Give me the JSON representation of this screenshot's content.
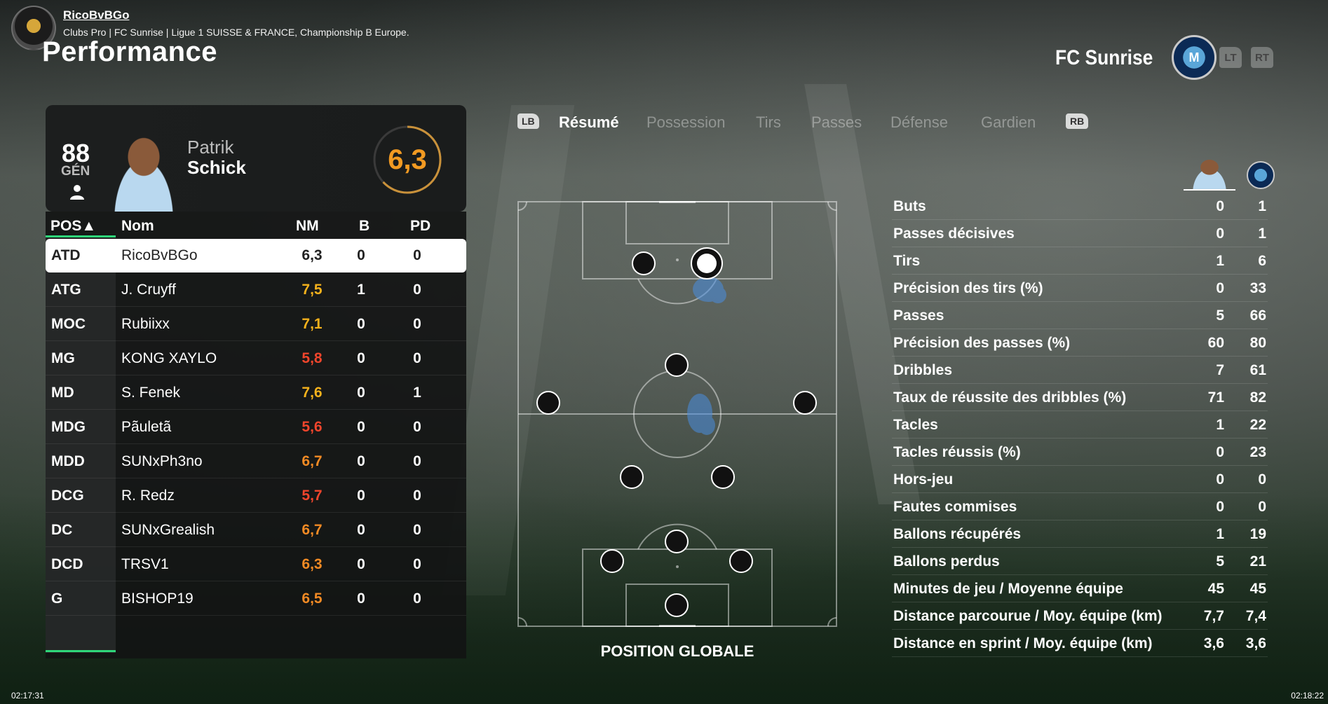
{
  "header": {
    "user_name": "RicoBvBGo",
    "subtitle": "Clubs Pro | FC Sunrise | Ligue 1 SUISSE & FRANCE, Championship B Europe.",
    "page_title": "Performance",
    "club_name": "FC Sunrise",
    "btn_lt": "LT",
    "btn_rt": "RT",
    "club_crest_text": "M"
  },
  "player": {
    "overall": "88",
    "overall_label": "GÉN",
    "first_name": "Patrik",
    "last_name": "Schick",
    "rating": "6,3",
    "rating_fraction": 0.63
  },
  "table": {
    "headers": {
      "pos": "POS▲",
      "nom": "Nom",
      "nm": "NM",
      "b": "B",
      "pd": "PD"
    },
    "rows": [
      {
        "pos": "ATD",
        "nom": "RicoBvBGo",
        "nm": "6,3",
        "b": "0",
        "pd": "0",
        "nm_color": "#222222",
        "selected": true
      },
      {
        "pos": "ATG",
        "nom": "J. Cruyff",
        "nm": "7,5",
        "b": "1",
        "pd": "0",
        "nm_color": "#f6b21c"
      },
      {
        "pos": "MOC",
        "nom": "Rubiixx",
        "nm": "7,1",
        "b": "0",
        "pd": "0",
        "nm_color": "#f6b21c"
      },
      {
        "pos": "MG",
        "nom": "KONG XAYLO",
        "nm": "5,8",
        "b": "0",
        "pd": "0",
        "nm_color": "#f0452c"
      },
      {
        "pos": "MD",
        "nom": "S. Fenek",
        "nm": "7,6",
        "b": "0",
        "pd": "1",
        "nm_color": "#f6b21c"
      },
      {
        "pos": "MDG",
        "nom": "Pãuletã",
        "nm": "5,6",
        "b": "0",
        "pd": "0",
        "nm_color": "#f0452c"
      },
      {
        "pos": "MDD",
        "nom": "SUNxPh3no",
        "nm": "6,7",
        "b": "0",
        "pd": "0",
        "nm_color": "#f28a24"
      },
      {
        "pos": "DCG",
        "nom": "R. Redz",
        "nm": "5,7",
        "b": "0",
        "pd": "0",
        "nm_color": "#f0452c"
      },
      {
        "pos": "DC",
        "nom": "SUNxGrealish",
        "nm": "6,7",
        "b": "0",
        "pd": "0",
        "nm_color": "#f28a24"
      },
      {
        "pos": "DCD",
        "nom": "TRSV1",
        "nm": "6,3",
        "b": "0",
        "pd": "0",
        "nm_color": "#f28a24"
      },
      {
        "pos": "G",
        "nom": "BISHOP19",
        "nm": "6,5",
        "b": "0",
        "pd": "0",
        "nm_color": "#f28a24"
      }
    ]
  },
  "tabs": {
    "lb": "LB",
    "rb": "RB",
    "items": [
      "Résumé",
      "Possession",
      "Tirs",
      "Passes",
      "Défense",
      "Gardien"
    ]
  },
  "pitch": {
    "label": "POSITION GLOBALE"
  },
  "stats": [
    {
      "label": "Buts",
      "player": "0",
      "team": "1"
    },
    {
      "label": "Passes décisives",
      "player": "0",
      "team": "1"
    },
    {
      "label": "Tirs",
      "player": "1",
      "team": "6"
    },
    {
      "label": "Précision des tirs (%)",
      "player": "0",
      "team": "33"
    },
    {
      "label": "Passes",
      "player": "5",
      "team": "66"
    },
    {
      "label": "Précision des passes (%)",
      "player": "60",
      "team": "80"
    },
    {
      "label": "Dribbles",
      "player": "7",
      "team": "61"
    },
    {
      "label": "Taux de réussite des dribbles (%)",
      "player": "71",
      "team": "82"
    },
    {
      "label": "Tacles",
      "player": "1",
      "team": "22"
    },
    {
      "label": "Tacles réussis (%)",
      "player": "0",
      "team": "23"
    },
    {
      "label": "Hors-jeu",
      "player": "0",
      "team": "0"
    },
    {
      "label": "Fautes commises",
      "player": "0",
      "team": "0"
    },
    {
      "label": "Ballons récupérés",
      "player": "1",
      "team": "19"
    },
    {
      "label": "Ballons perdus",
      "player": "5",
      "team": "21"
    },
    {
      "label": "Minutes de jeu / Moyenne équipe",
      "player": "45",
      "team": "45"
    },
    {
      "label": "Distance parcourue / Moy. équipe (km)",
      "player": "7,7",
      "team": "7,4"
    },
    {
      "label": "Distance en sprint / Moy. équipe (km)",
      "player": "3,6",
      "team": "3,6"
    }
  ],
  "timestamps": {
    "left": "02:17:31",
    "right": "02:18:22"
  },
  "colors": {
    "accent": "#2fd67a",
    "rating": "#f29a22"
  }
}
